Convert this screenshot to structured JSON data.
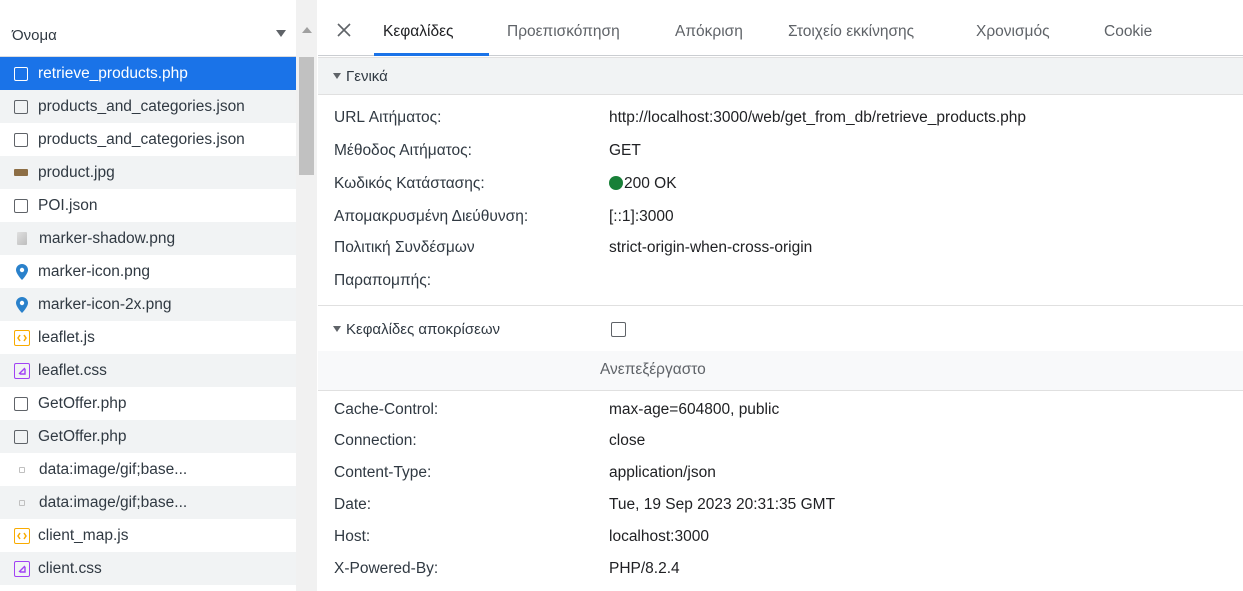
{
  "left_panel": {
    "header": "Όνομα",
    "rows": [
      {
        "label": "retrieve_products.php",
        "icon": "document-icon",
        "selected": true
      },
      {
        "label": "products_and_categories.json",
        "icon": "document-icon"
      },
      {
        "label": "products_and_categories.json",
        "icon": "document-icon"
      },
      {
        "label": "product.jpg",
        "icon": "image-icon"
      },
      {
        "label": "POI.json",
        "icon": "document-icon"
      },
      {
        "label": "marker-shadow.png",
        "icon": "image-icon"
      },
      {
        "label": "marker-icon.png",
        "icon": "map-marker-icon"
      },
      {
        "label": "marker-icon-2x.png",
        "icon": "map-marker-icon"
      },
      {
        "label": "leaflet.js",
        "icon": "script-icon"
      },
      {
        "label": "leaflet.css",
        "icon": "stylesheet-icon"
      },
      {
        "label": "GetOffer.php",
        "icon": "document-icon"
      },
      {
        "label": "GetOffer.php",
        "icon": "document-icon"
      },
      {
        "label": "data:image/gif;base...",
        "icon": "data-icon"
      },
      {
        "label": "data:image/gif;base...",
        "icon": "data-icon"
      },
      {
        "label": "client_map.js",
        "icon": "script-icon"
      },
      {
        "label": "client.css",
        "icon": "stylesheet-icon"
      }
    ]
  },
  "tabs": [
    {
      "label": "Κεφαλίδες",
      "active": true
    },
    {
      "label": "Προεπισκόπηση"
    },
    {
      "label": "Απόκριση"
    },
    {
      "label": "Στοιχείο εκκίνησης"
    },
    {
      "label": "Χρονισμός"
    },
    {
      "label": "Cookie"
    }
  ],
  "general": {
    "title": "Γενικά",
    "rows": [
      {
        "key": "URL Αιτήματος:",
        "value": "http://localhost:3000/web/get_from_db/retrieve_products.php"
      },
      {
        "key": "Μέθοδος Αιτήματος:",
        "value": "GET"
      },
      {
        "key": "Κωδικός Κατάστασης:",
        "value": "200 OK"
      },
      {
        "key": "Απομακρυσμένη Διεύθυνση:",
        "value": "[::1]:3000"
      },
      {
        "key": "Πολιτική Συνδέσμων",
        "value": "strict-origin-when-cross-origin"
      },
      {
        "key": "Παραπομπής:",
        "value": ""
      }
    ]
  },
  "response_headers": {
    "title": "Κεφαλίδες αποκρίσεων",
    "raw_label": "Ανεπεξέργαστο",
    "rows": [
      {
        "key": "Cache-Control:",
        "value": "max-age=604800, public"
      },
      {
        "key": "Connection:",
        "value": "close"
      },
      {
        "key": "Content-Type:",
        "value": "application/json"
      },
      {
        "key": "Date:",
        "value": "Tue, 19 Sep 2023 20:31:35 GMT"
      },
      {
        "key": "Host:",
        "value": "localhost:3000"
      },
      {
        "key": "X-Powered-By:",
        "value": "PHP/8.2.4"
      }
    ]
  },
  "colors": {
    "accent": "#1a73e8",
    "status_ok": "#188038"
  }
}
